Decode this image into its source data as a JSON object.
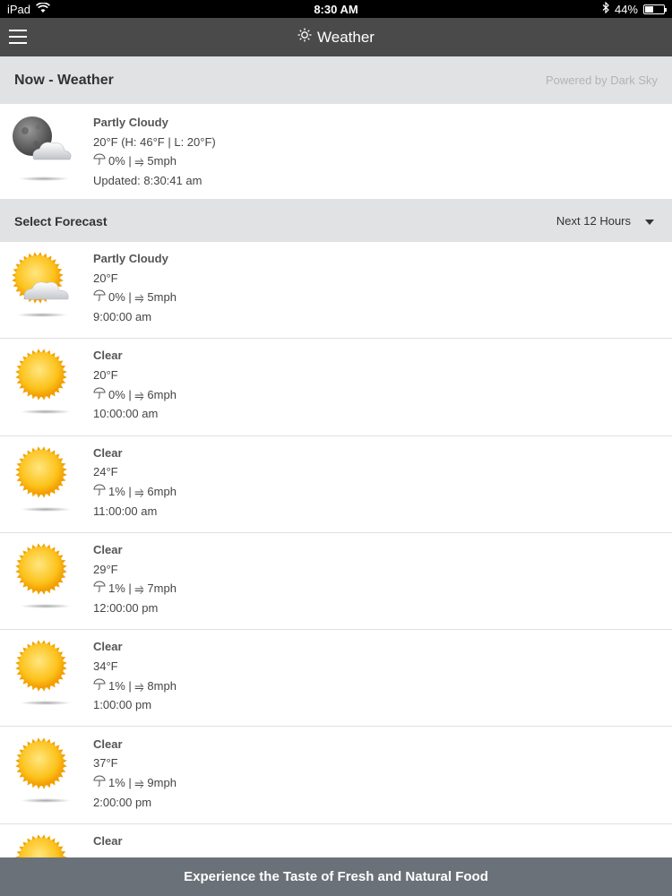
{
  "status_bar": {
    "device": "iPad",
    "time": "8:30 AM",
    "battery": "44%",
    "battery_level": 0.44
  },
  "nav": {
    "title": "Weather"
  },
  "now": {
    "heading": "Now - Weather",
    "powered_by": "Powered by Dark Sky",
    "condition": "Partly Cloudy",
    "temp": "20°F (H: 46°F | L: 20°F)",
    "precip_wind": "0% | ⥤ 5mph",
    "updated": "Updated: 8:30:41 am",
    "icon": "moon-cloud-icon"
  },
  "forecast": {
    "heading": "Select Forecast",
    "range": "Next 12 Hours",
    "items": [
      {
        "condition": "Partly Cloudy",
        "temp": "20°F",
        "precip_wind": "0% | ⥤ 5mph",
        "time": "9:00:00 am",
        "icon": "sun-cloud-icon"
      },
      {
        "condition": "Clear",
        "temp": "20°F",
        "precip_wind": "0% | ⥤ 6mph",
        "time": "10:00:00 am",
        "icon": "sun-icon"
      },
      {
        "condition": "Clear",
        "temp": "24°F",
        "precip_wind": "1% | ⥤ 6mph",
        "time": "11:00:00 am",
        "icon": "sun-icon"
      },
      {
        "condition": "Clear",
        "temp": "29°F",
        "precip_wind": "1% | ⥤ 7mph",
        "time": "12:00:00 pm",
        "icon": "sun-icon"
      },
      {
        "condition": "Clear",
        "temp": "34°F",
        "precip_wind": "1% | ⥤ 8mph",
        "time": "1:00:00 pm",
        "icon": "sun-icon"
      },
      {
        "condition": "Clear",
        "temp": "37°F",
        "precip_wind": "1% | ⥤ 9mph",
        "time": "2:00:00 pm",
        "icon": "sun-icon"
      },
      {
        "condition": "Clear",
        "temp": "",
        "precip_wind": "",
        "time": "",
        "icon": "sun-icon"
      }
    ]
  },
  "footer": {
    "text": "Experience the Taste of Fresh and Natural Food"
  },
  "colors": {
    "navbar": "#4a4a4a",
    "section_bg": "#e1e2e3",
    "footer": "#6b7178",
    "sun": "#f5b50a"
  }
}
